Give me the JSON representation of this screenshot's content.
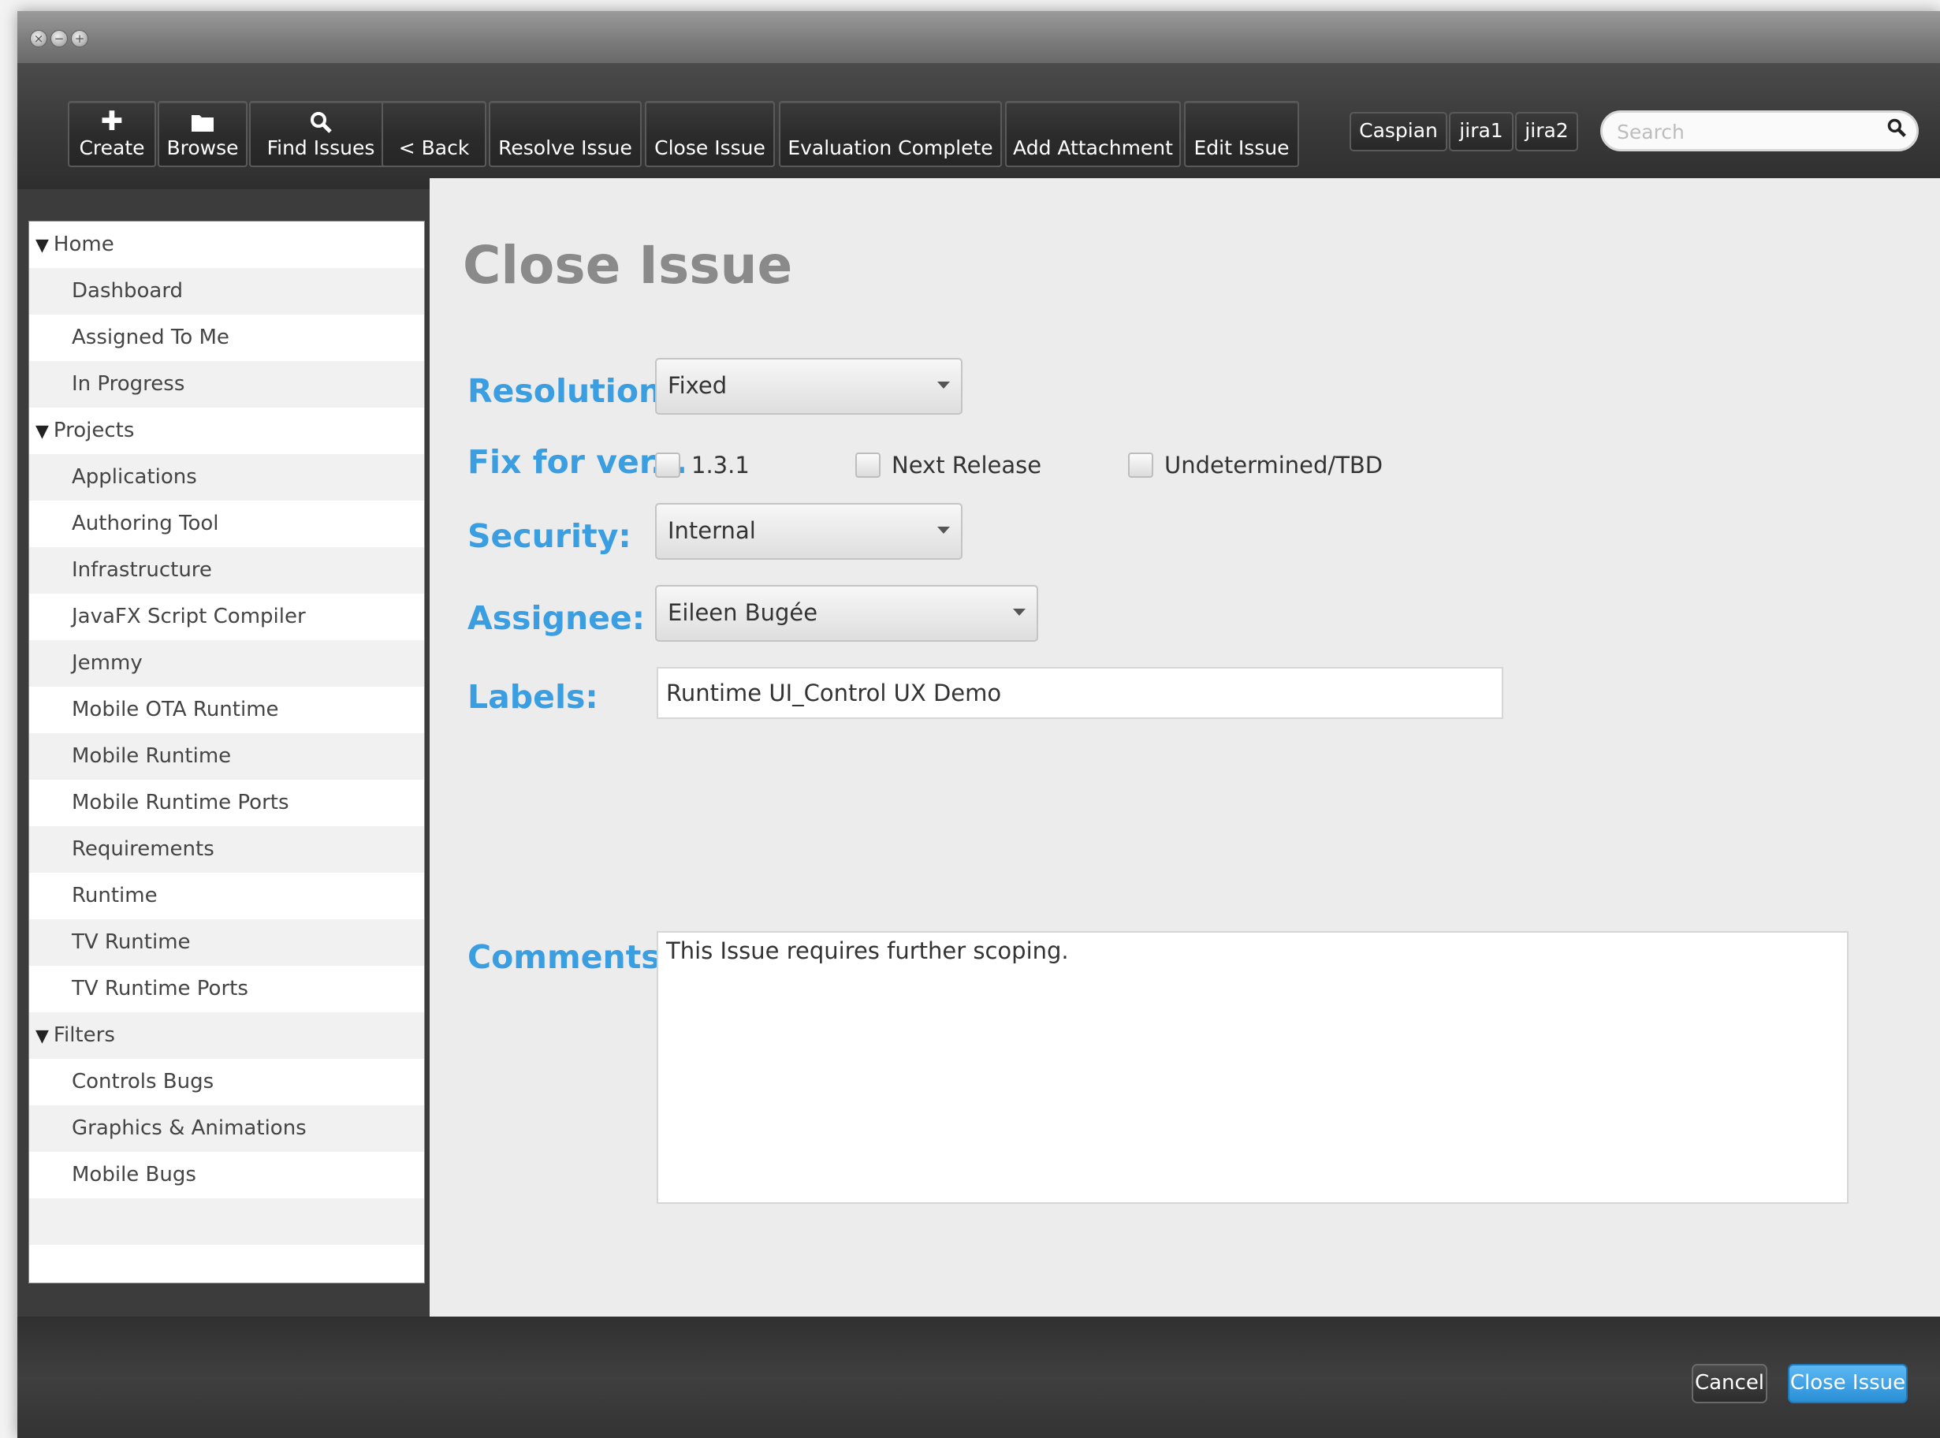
{
  "titlebar": {
    "buttons": [
      "close",
      "minimize",
      "zoom"
    ]
  },
  "toolbar": {
    "create": {
      "label": "Create",
      "icon": "plus-icon"
    },
    "browse": {
      "label": "Browse",
      "icon": "folder-icon"
    },
    "find": {
      "label": "Find Issues",
      "icon": "search-icon"
    },
    "back": "< Back",
    "resolve": "Resolve Issue",
    "close": "Close Issue",
    "evaluation": "Evaluation Complete",
    "attach": "Add Attachment",
    "edit": "Edit Issue",
    "servers": [
      "Caspian",
      "jira1",
      "jira2"
    ],
    "search_placeholder": "Search"
  },
  "sidebar": {
    "home": {
      "label": "Home",
      "items": [
        "Dashboard",
        "Assigned To Me",
        "In Progress"
      ]
    },
    "projects": {
      "label": "Projects",
      "items": [
        "Applications",
        "Authoring Tool",
        "Infrastructure",
        "JavaFX Script Compiler",
        "Jemmy",
        "Mobile OTA Runtime",
        "Mobile Runtime",
        "Mobile Runtime Ports",
        "Requirements",
        "Runtime",
        "TV Runtime",
        "TV Runtime Ports"
      ]
    },
    "filters": {
      "label": "Filters",
      "items": [
        "Controls Bugs",
        "Graphics & Animations",
        "Mobile Bugs"
      ]
    }
  },
  "form": {
    "title": "Close Issue",
    "resolution": {
      "label": "Resolution:",
      "value": "Fixed"
    },
    "fixfor": {
      "label": "Fix for ver...",
      "options": [
        "1.3.1",
        "Next Release",
        "Undetermined/TBD"
      ]
    },
    "security": {
      "label": "Security:",
      "value": "Internal"
    },
    "assignee": {
      "label": "Assignee:",
      "value": "Eileen Bugée"
    },
    "labels": {
      "label": "Labels:",
      "value": "Runtime UI_Control UX Demo"
    },
    "comments": {
      "label": "Comments:",
      "value": "This Issue requires further scoping."
    }
  },
  "footer": {
    "cancel": "Cancel",
    "close": "Close Issue"
  },
  "colors": {
    "accent": "#3b9ee0",
    "primary_button": "#2a8fd6",
    "toolbar_bg": "#3a3a3a"
  }
}
